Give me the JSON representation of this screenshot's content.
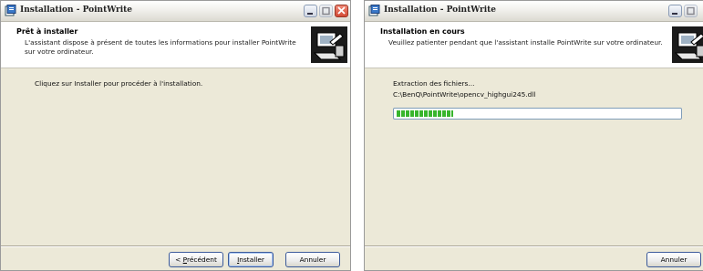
{
  "left_window": {
    "title": "Installation - PointWrite",
    "header_title": "Prêt à installer",
    "header_subtitle_line1": "L'assistant dispose à présent de toutes les informations pour installer PointWrite",
    "header_subtitle_line2": "sur votre ordinateur.",
    "body_text": "Cliquez sur Installer pour procéder à l'installation.",
    "buttons": {
      "back": {
        "prefix": "< ",
        "mnemonic": "P",
        "rest": "récédent"
      },
      "install": {
        "mnemonic": "I",
        "rest": "nstaller"
      },
      "cancel": "Annuler"
    }
  },
  "right_window": {
    "title": "Installation - PointWrite",
    "header_title": "Installation en cours",
    "header_subtitle": "Veuillez patienter pendant que l'assistant installe PointWrite sur votre ordinateur.",
    "status_line": "Extraction des fichiers...",
    "file_path": "C:\\BenQ\\PointWrite\\opencv_highgui245.dll",
    "progress_fraction": 0.2,
    "buttons": {
      "cancel": "Annuler"
    }
  },
  "colors": {
    "progress_green": "#37b52c",
    "dialog_bg": "#ece9d8"
  },
  "icons": [
    "installer-app-icon",
    "minimize-icon",
    "maximize-icon",
    "close-icon",
    "computer-install-icon"
  ]
}
